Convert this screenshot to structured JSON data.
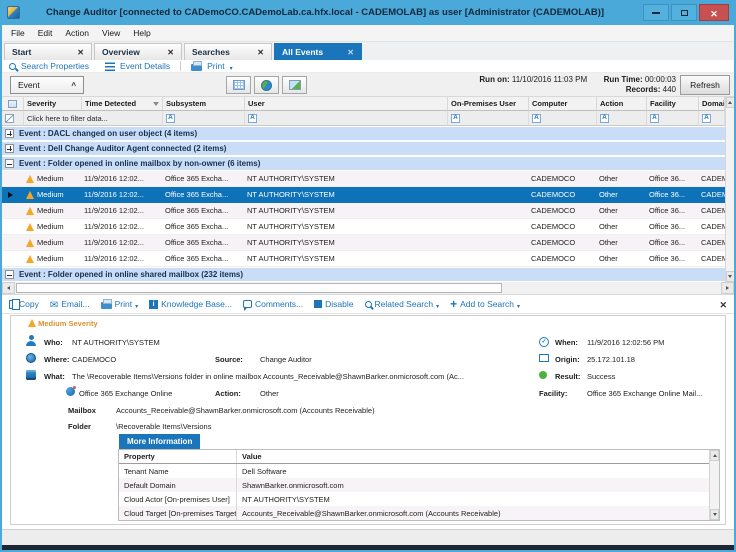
{
  "window": {
    "title": "Change Auditor [connected to CADemoCO.CADemoLab.ca.hfx.local - CADEMOLAB] as user [Administrator (CADEMOLAB)]"
  },
  "menu": {
    "items": [
      "File",
      "Edit",
      "Action",
      "View",
      "Help"
    ]
  },
  "tabs": [
    {
      "label": "Start"
    },
    {
      "label": "Overview"
    },
    {
      "label": "Searches"
    },
    {
      "label": "All Events",
      "active": true
    }
  ],
  "toolbar": {
    "search_properties": "Search Properties",
    "event_details": "Event Details",
    "print": "Print"
  },
  "run_bar": {
    "event_button": "Event",
    "run_on_label": "Run on:",
    "run_on_value": "11/10/2016 11:03 PM",
    "run_time_label": "Run Time:",
    "run_time_value": "00:00:03",
    "records_label": "Records:",
    "records_value": "440",
    "refresh_label": "Refresh"
  },
  "grid": {
    "columns": [
      "Severity",
      "Time Detected",
      "Subsystem",
      "User",
      "On-Premises User",
      "Computer",
      "Action",
      "Facility",
      "Domain"
    ],
    "filter_prompt": "Click here to filter data...",
    "groups": [
      {
        "expanded": false,
        "label": "Event : DACL changed on user object (4 items)"
      },
      {
        "expanded": false,
        "label": "Event : Dell Change Auditor Agent connected (2 items)"
      },
      {
        "expanded": true,
        "label": "Event : Folder opened in online mailbox by non-owner (6 items)",
        "has_rows": true
      },
      {
        "expanded": true,
        "label": "Event : Folder opened in online shared mailbox (232 items)"
      }
    ],
    "rows": [
      {
        "severity": "Medium",
        "time_detected": "11/9/2016 12:02...",
        "subsystem": "Office 365 Excha...",
        "user": "NT AUTHORITY\\SYSTEM",
        "on_premises_user": "",
        "computer": "CADEMOCO",
        "action": "Other",
        "facility": "Office 36...",
        "domain": "CADEM...",
        "current": false
      },
      {
        "severity": "Medium",
        "time_detected": "11/9/2016 12:02...",
        "subsystem": "Office 365 Excha...",
        "user": "NT AUTHORITY\\SYSTEM",
        "on_premises_user": "",
        "computer": "CADEMOCO",
        "action": "Other",
        "facility": "Office 36...",
        "domain": "CADEM...",
        "current": true
      },
      {
        "severity": "Medium",
        "time_detected": "11/9/2016 12:02...",
        "subsystem": "Office 365 Excha...",
        "user": "NT AUTHORITY\\SYSTEM",
        "on_premises_user": "",
        "computer": "CADEMOCO",
        "action": "Other",
        "facility": "Office 36...",
        "domain": "CADEM...",
        "current": false
      },
      {
        "severity": "Medium",
        "time_detected": "11/9/2016 12:02...",
        "subsystem": "Office 365 Excha...",
        "user": "NT AUTHORITY\\SYSTEM",
        "on_premises_user": "",
        "computer": "CADEMOCO",
        "action": "Other",
        "facility": "Office 36...",
        "domain": "CADEM...",
        "current": false
      },
      {
        "severity": "Medium",
        "time_detected": "11/9/2016 12:02...",
        "subsystem": "Office 365 Excha...",
        "user": "NT AUTHORITY\\SYSTEM",
        "on_premises_user": "",
        "computer": "CADEMOCO",
        "action": "Other",
        "facility": "Office 36...",
        "domain": "CADEM...",
        "current": false
      },
      {
        "severity": "Medium",
        "time_detected": "11/9/2016 12:02...",
        "subsystem": "Office 365 Excha...",
        "user": "NT AUTHORITY\\SYSTEM",
        "on_premises_user": "",
        "computer": "CADEMOCO",
        "action": "Other",
        "facility": "Office 36...",
        "domain": "CADEM...",
        "current": false
      }
    ]
  },
  "detail_toolbar": {
    "copy": "Copy",
    "email": "Email...",
    "print": "Print",
    "knowledge_base": "Knowledge Base...",
    "comments": "Comments...",
    "disable": "Disable",
    "related_search": "Related Search",
    "add_to_search": "Add to Search"
  },
  "detail": {
    "severity_text": "Medium Severity",
    "who_label": "Who:",
    "who_value": "NT AUTHORITY\\SYSTEM",
    "where_label": "Where:",
    "where_value": "CADEMOCO",
    "source_label": "Source:",
    "source_value": "Change Auditor",
    "when_label": "When:",
    "when_value": "11/9/2016 12:02:56 PM",
    "origin_label": "Origin:",
    "origin_value": "25.172.101.18",
    "what_label": "What:",
    "what_value": "The \\Recoverable Items\\Versions folder in online mailbox Accounts_Receivable@ShawnBarker.onmicrosoft.com (Ac...",
    "result_label": "Result:",
    "result_value": "Success",
    "subsystem_value": "Office 365 Exchange Online",
    "action_label": "Action:",
    "action_value": "Other",
    "facility_label": "Facility:",
    "facility_value": "Office 365 Exchange Online Mail...",
    "mailbox_label": "Mailbox",
    "mailbox_value": "Accounts_Receivable@ShawnBarker.onmicrosoft.com (Accounts Receivable)",
    "folder_label": "Folder",
    "folder_value": "\\Recoverable Items\\Versions",
    "more_info_tab": "More Information",
    "table": {
      "headers": [
        "Property",
        "Value"
      ],
      "rows": [
        [
          "Tenant Name",
          "Dell Software"
        ],
        [
          "Default Domain",
          "ShawnBarker.onmicrosoft.com"
        ],
        [
          "Cloud Actor [On-premises User]",
          "NT AUTHORITY\\SYSTEM"
        ],
        [
          "Cloud Target [On-premises Target]",
          "Accounts_Receivable@ShawnBarker.onmicrosoft.com (Accounts Receivable)"
        ]
      ]
    }
  },
  "colors": {
    "accent": "#1b75bb",
    "titlebar": "#4aa9d9",
    "selected_row": "#0e72b8",
    "group_row": "#c9ddf7",
    "warning": "#f5a623",
    "success": "#4cb140",
    "close_button": "#c75050"
  },
  "icons": {
    "app-icon": "change-auditor-shield",
    "search-icon": "magnifier",
    "event-details-icon": "list",
    "print-icon": "printer",
    "grid-view-icon": "table-grid",
    "chart-view-icon": "pie-chart",
    "export-view-icon": "image-export",
    "filter-a-icon": "A",
    "sort-desc-icon": "chevron-down",
    "warning-icon": "orange-triangle",
    "copy-icon": "clipboard",
    "email-icon": "envelope",
    "knowledge-base-icon": "info-square",
    "comments-icon": "speech-bubble",
    "disable-icon": "blue-square",
    "related-search-icon": "magnifier",
    "add-to-search-icon": "plus",
    "close-icon": "x",
    "who-icon": "person",
    "where-icon": "globe",
    "what-icon": "database",
    "when-icon": "clock-check",
    "origin-icon": "screen",
    "result-icon": "green-dot",
    "exchange-icon": "exchange-sphere"
  }
}
